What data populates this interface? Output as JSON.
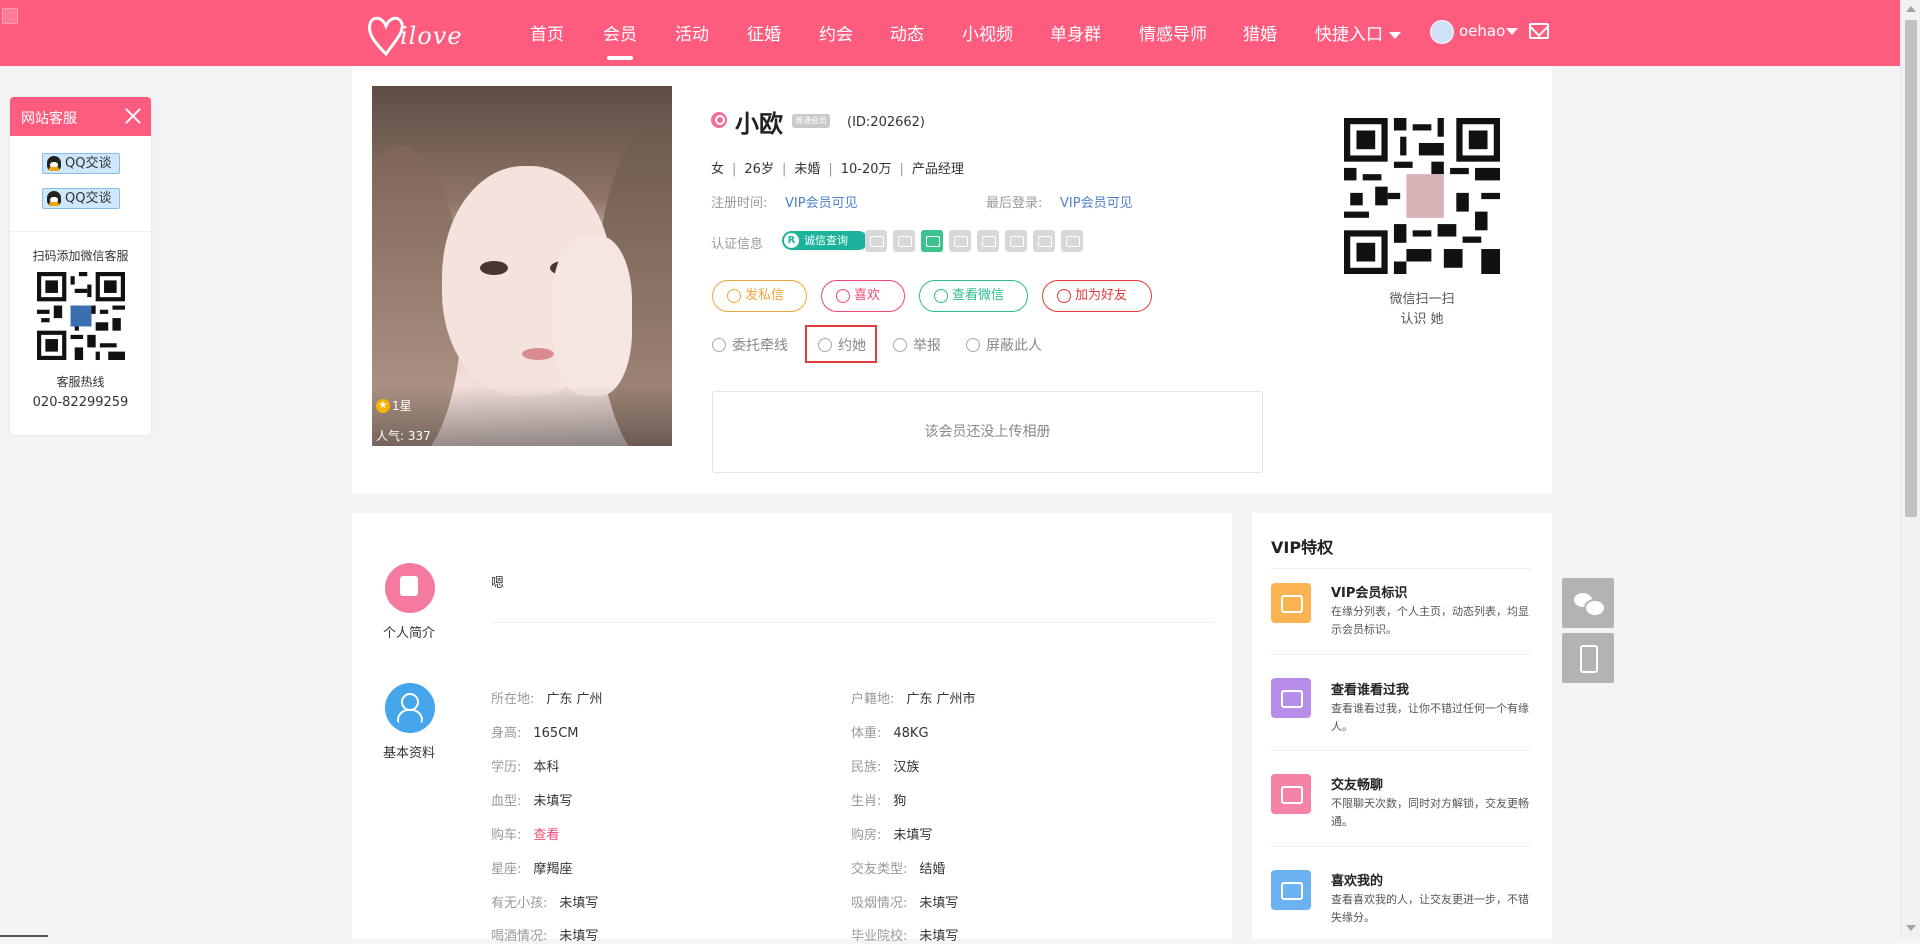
{
  "header": {
    "nav": [
      "首页",
      "会员",
      "活动",
      "征婚",
      "约会",
      "动态",
      "小视频",
      "单身群",
      "情感导师",
      "猎婚",
      "快捷入口"
    ],
    "active": "会员",
    "logo_text": "ilove",
    "user_name": "oehao"
  },
  "service": {
    "title": "网站客服",
    "qq_buttons": [
      "QQ交谈",
      "QQ交谈"
    ],
    "wechat_text": "扫码添加微信客服",
    "hotline_label": "客服热线",
    "hotline": "020-82299259"
  },
  "profile": {
    "name": "小欧",
    "badge": "普通会员",
    "id": "(ID:202662)",
    "meta": [
      "女",
      "26岁",
      "未婚",
      "10-20万",
      "产品经理"
    ],
    "reg_label": "注册时间:",
    "reg_value": "VIP会员可见",
    "login_label": "最后登录:",
    "login_value": "VIP会员可见",
    "cert_label": "认证信息",
    "cert_query": "诚信查询",
    "star": "1星",
    "popularity": "人气: 337",
    "actions": [
      "发私信",
      "喜欢",
      "查看微信",
      "加为好友"
    ],
    "sub_actions": [
      "委托牵线",
      "约她",
      "举报",
      "屏蔽此人"
    ],
    "album_empty": "该会员还没上传相册",
    "qr_caption1": "微信扫一扫",
    "qr_caption2": "认识 她"
  },
  "colors": {
    "brand": "#fd5c7f",
    "link": "#4e7fc9",
    "teal": "#1bb39a"
  },
  "detail": {
    "intro_title": "个人简介",
    "intro_text": "嗯",
    "basic_title": "基本资料",
    "fields_left": [
      {
        "k": "所在地:",
        "v": "广东 广州"
      },
      {
        "k": "身高:",
        "v": "165CM"
      },
      {
        "k": "学历:",
        "v": "本科"
      },
      {
        "k": "血型:",
        "v": "未填写"
      },
      {
        "k": "购车:",
        "v": "查看"
      },
      {
        "k": "星座:",
        "v": "摩羯座"
      },
      {
        "k": "有无小孩:",
        "v": "未填写"
      },
      {
        "k": "喝酒情况:",
        "v": "未填写"
      }
    ],
    "fields_right": [
      {
        "k": "户籍地:",
        "v": "广东 广州市"
      },
      {
        "k": "体重:",
        "v": "48KG"
      },
      {
        "k": "民族:",
        "v": "汉族"
      },
      {
        "k": "生肖:",
        "v": "狗"
      },
      {
        "k": "购房:",
        "v": "未填写"
      },
      {
        "k": "交友类型:",
        "v": "结婚"
      },
      {
        "k": "吸烟情况:",
        "v": "未填写"
      },
      {
        "k": "毕业院校:",
        "v": "未填写"
      }
    ]
  },
  "vip": {
    "title": "VIP特权",
    "items": [
      {
        "h": "VIP会员标识",
        "d": "在缘分列表，个人主页，动态列表，均显示会员标识。"
      },
      {
        "h": "查看谁看过我",
        "d": "查看谁看过我，让你不错过任何一个有缘人。"
      },
      {
        "h": "交友畅聊",
        "d": "不限聊天次数，同时对方解锁，交友更畅通。"
      },
      {
        "h": "喜欢我的",
        "d": "查看喜欢我的人，让交友更进一步，不错失缘分。"
      }
    ]
  }
}
